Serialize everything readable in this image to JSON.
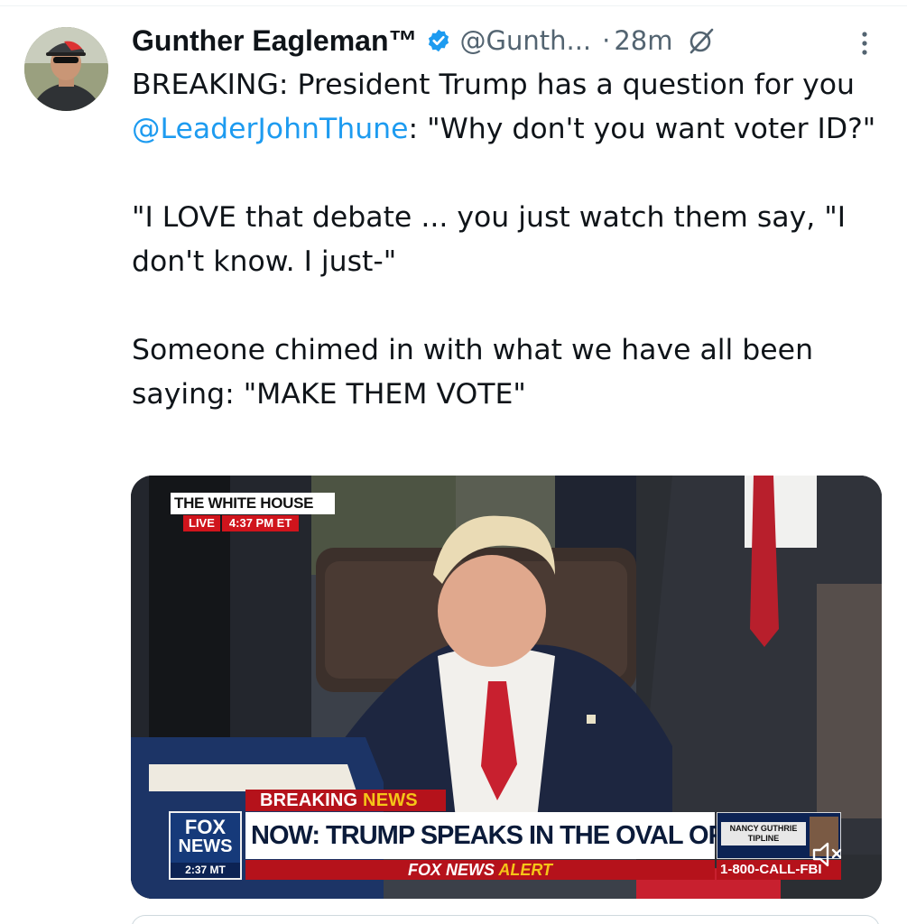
{
  "tweet": {
    "author": {
      "display_name": "Gunther Eagleman™",
      "handle": "@Gunth...",
      "verified": true,
      "avatar_icon": "user-avatar"
    },
    "separator": "·",
    "timestamp": "28m",
    "text": {
      "para1_prefix": "BREAKING: President Trump has a question for you ",
      "mention": "@LeaderJohnThune",
      "para1_suffix": ": \"Why don't you want voter ID?\"",
      "para2": "\"I LOVE that debate ... you just watch them say, \"I don't know. I just-\"",
      "para3": "Someone chimed in with what we have all been saying: \"MAKE THEM VOTE\""
    },
    "colors": {
      "text": "#0f1419",
      "secondary": "#536471",
      "link": "#1d9bf0",
      "verified": "#1d9bf0"
    },
    "video": {
      "bug_title": "THE WHITE HOUSE",
      "bug_live": "LIVE",
      "bug_time": "4:37 PM ET",
      "breaking_label_1": "BREAKING",
      "breaking_label_2": "NEWS",
      "network_word_1": "FOX",
      "network_word_2": "NEWS",
      "network_clock": "2:37 MT",
      "headline": "NOW: TRUMP SPEAKS IN THE OVAL OFFICE",
      "alert_prefix": "FOX NEWS",
      "alert_word": "ALERT",
      "tipline_label": "NANCY GUTHRIE TIPLINE",
      "tipline_phone": "1-800-CALL-FBI",
      "muted": true
    }
  }
}
